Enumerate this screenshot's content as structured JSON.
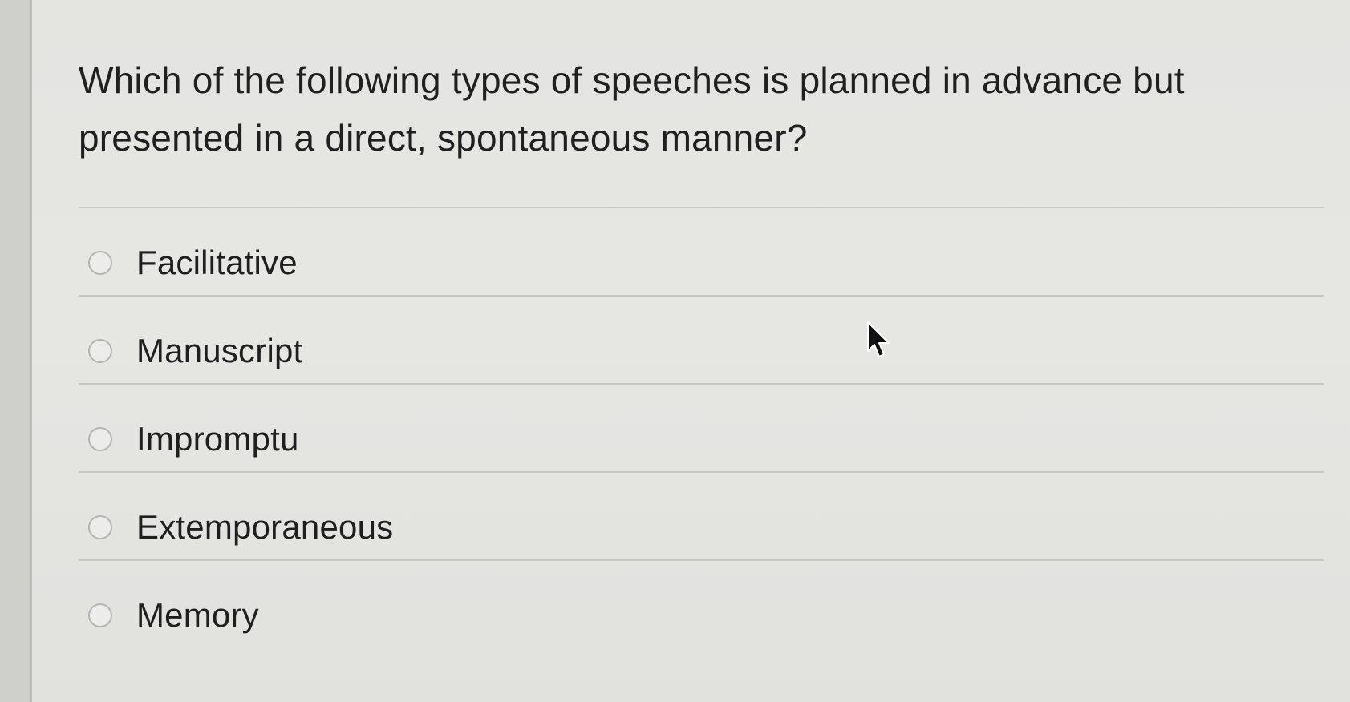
{
  "question": {
    "text": "Which of the following types of speeches is planned in advance but presented in a direct, spontaneous manner?"
  },
  "options": [
    {
      "label": "Facilitative",
      "selected": false
    },
    {
      "label": "Manuscript",
      "selected": false
    },
    {
      "label": "Impromptu",
      "selected": false
    },
    {
      "label": "Extemporaneous",
      "selected": false
    },
    {
      "label": "Memory",
      "selected": false
    }
  ],
  "cursor": {
    "icon": "mouse-pointer-icon"
  }
}
